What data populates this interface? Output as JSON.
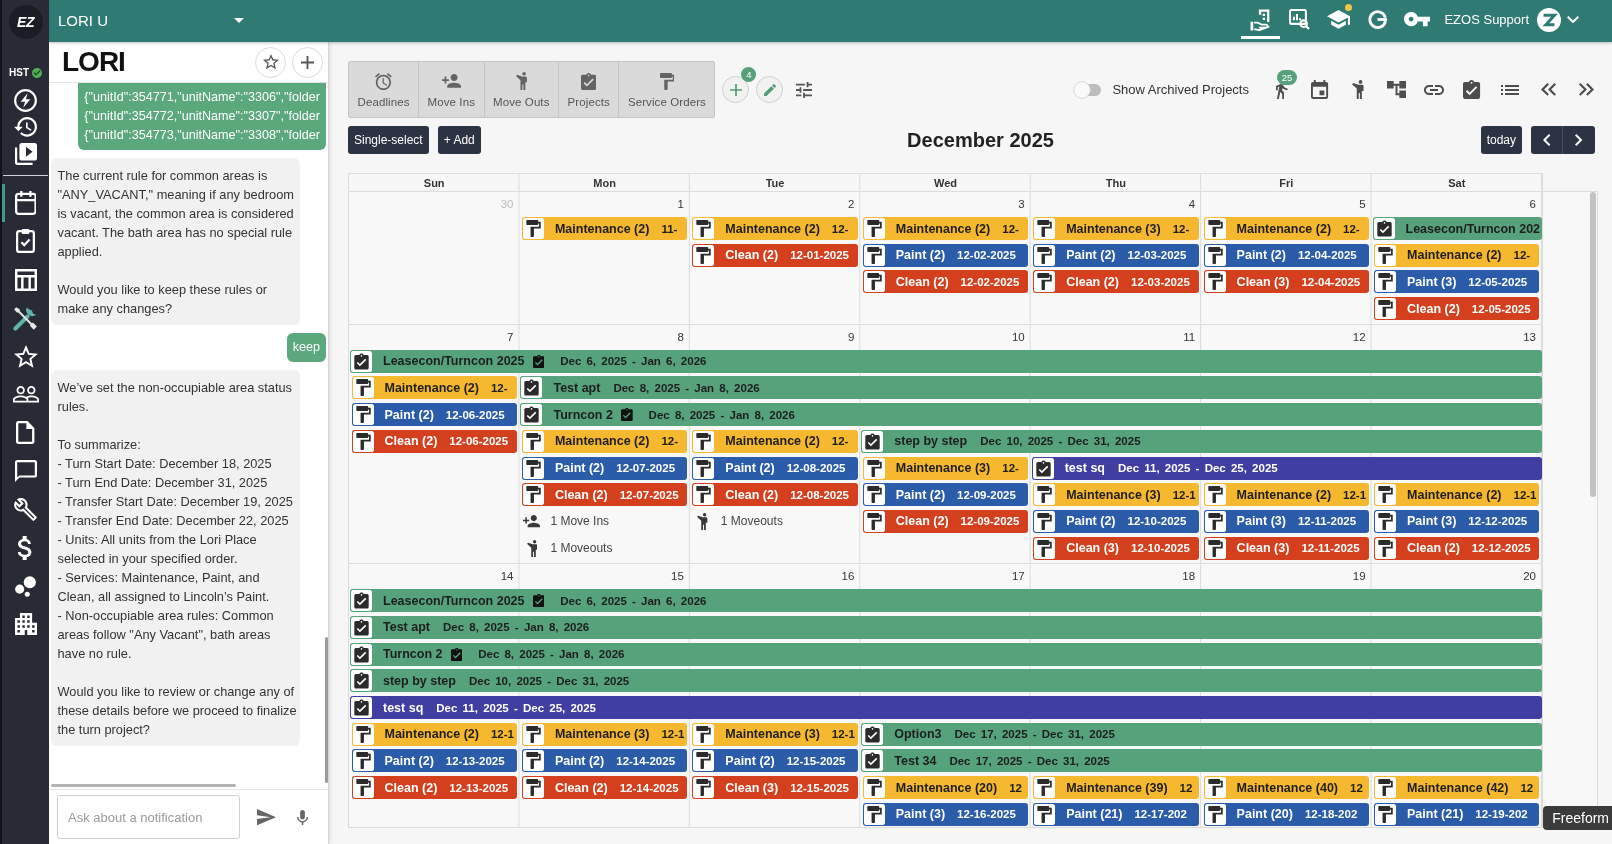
{
  "rail": {
    "logo": "EZ",
    "status": "HST",
    "tools": [
      {
        "selected": false
      },
      {
        "selected": false
      },
      {
        "selected": false
      }
    ],
    "items": [
      {
        "selected": true
      },
      {
        "selected": false
      },
      {
        "selected": false
      },
      {
        "selected": false
      },
      {
        "selected": false
      },
      {
        "selected": false
      },
      {
        "selected": false
      },
      {
        "selected": false
      },
      {
        "selected": false
      },
      {
        "selected": false
      },
      {
        "selected": false
      },
      {
        "selected": false
      }
    ]
  },
  "header": {
    "account": "LORI U",
    "tabs": [
      {
        "selected": true,
        "notification": false
      },
      {
        "selected": false,
        "notification": false
      },
      {
        "selected": false,
        "notification": true
      },
      {
        "selected": false,
        "notification": false
      },
      {
        "selected": false,
        "notification": false
      }
    ],
    "user": "EZOS Support"
  },
  "assistant": {
    "brand": "LORI",
    "messages": [
      {
        "kind": "user",
        "text": "{\"unitId\":354771,\"unitName\":\"3306\",\"folder\n{\"unitId\":354772,\"unitName\":\"3307\",\"folder\n{\"unitId\":354773,\"unitName\":\"3308\",\"folder"
      },
      {
        "kind": "assistant",
        "text": "The current rule for common areas is \"ANY_VACANT,\" meaning if any bedroom is vacant, the common area is considered vacant. The bath area has no special rule applied.\n\nWould you like to keep these rules or make any changes?"
      },
      {
        "kind": "user",
        "text": "keep"
      },
      {
        "kind": "assistant",
        "text": "We’ve set the non-occupiable area status rules.\n\nTo summarize:\n- Turn Start Date: December 18, 2025\n- Turn End Date: December 31, 2025\n- Transfer Start Date: December 19, 2025\n- Transfer End Date: December 22, 2025\n- Units: All units from the Lori Place selected in your specified order.\n- Services: Maintenance, Paint, and Clean, all assigned to Lincoln’s Paint.\n- Non-occupiable area rules: Common areas follow \"Any Vacant\", bath areas have no rule.\n\nWould you like to review or change any of these details before we proceed to finalize the turn project?"
      }
    ],
    "input": {
      "placeholder": "Ask about a notification"
    }
  },
  "toolbar": {
    "views": [
      {
        "label": "Deadlines"
      },
      {
        "label": "Move Ins"
      },
      {
        "label": "Move Outs"
      },
      {
        "label": "Projects"
      },
      {
        "label": "Service Orders"
      }
    ],
    "add_badge": "4",
    "archived": {
      "label": "Show Archived Projects",
      "on": false
    },
    "badge": "25"
  },
  "calendar": {
    "select_button": "Single-select",
    "add_button": "+ Add",
    "title": "December 2025",
    "today_button": "today",
    "weekdays": [
      "Sun",
      "Mon",
      "Tue",
      "Wed",
      "Thu",
      "Fri",
      "Sat"
    ],
    "weeks": [
      {
        "days": [
          {
            "number": "30",
            "other_month": true
          },
          {
            "number": "1",
            "other_month": false
          },
          {
            "number": "2",
            "other_month": false
          },
          {
            "number": "3",
            "other_month": false
          },
          {
            "number": "4",
            "other_month": false
          },
          {
            "number": "5",
            "other_month": false
          },
          {
            "number": "6",
            "other_month": false
          }
        ],
        "lanes": [
          [
            {
              "kind": "gap"
            },
            {
              "kind": "task",
              "label": "Maintenance (2)",
              "date": "11-",
              "color": "#f5b82e"
            },
            {
              "kind": "task",
              "label": "Maintenance (2)",
              "date": "12-",
              "color": "#f5b82e"
            },
            {
              "kind": "task",
              "label": "Maintenance (2)",
              "date": "12-",
              "color": "#f5b82e"
            },
            {
              "kind": "task",
              "label": "Maintenance (3)",
              "date": "12-",
              "color": "#f5b82e"
            },
            {
              "kind": "task",
              "label": "Maintenance (2)",
              "date": "12-",
              "color": "#f5b82e"
            },
            {
              "kind": "project",
              "label": "Leasecon/Turncon 202",
              "color": "#56a27a"
            }
          ],
          [
            {
              "kind": "gap"
            },
            {
              "kind": "gap"
            },
            {
              "kind": "task",
              "label": "Clean (2)",
              "date": "12-01-2025",
              "color": "#d4401e"
            },
            {
              "kind": "task",
              "label": "Paint (2)",
              "date": "12-02-2025",
              "color": "#2a5caa"
            },
            {
              "kind": "task",
              "label": "Paint (2)",
              "date": "12-03-2025",
              "color": "#2a5caa"
            },
            {
              "kind": "task",
              "label": "Paint (2)",
              "date": "12-04-2025",
              "color": "#2a5caa"
            },
            {
              "kind": "task",
              "label": "Maintenance (2)",
              "date": "12-",
              "color": "#f5b82e"
            }
          ],
          [
            {
              "kind": "gap"
            },
            {
              "kind": "gap"
            },
            {
              "kind": "gap"
            },
            {
              "kind": "task",
              "label": "Clean (2)",
              "date": "12-02-2025",
              "color": "#d4401e"
            },
            {
              "kind": "task",
              "label": "Clean (2)",
              "date": "12-03-2025",
              "color": "#d4401e"
            },
            {
              "kind": "task",
              "label": "Clean (3)",
              "date": "12-04-2025",
              "color": "#d4401e"
            },
            {
              "kind": "task",
              "label": "Paint (3)",
              "date": "12-05-2025",
              "color": "#2a5caa"
            }
          ],
          [
            {
              "kind": "gap"
            },
            {
              "kind": "gap"
            },
            {
              "kind": "gap"
            },
            {
              "kind": "gap"
            },
            {
              "kind": "gap"
            },
            {
              "kind": "gap"
            },
            {
              "kind": "task",
              "label": "Clean (2)",
              "date": "12-05-2025",
              "color": "#d4401e"
            }
          ]
        ]
      },
      {
        "days": [
          {
            "number": "7",
            "other_month": false
          },
          {
            "number": "8",
            "other_month": false
          },
          {
            "number": "9",
            "other_month": false
          },
          {
            "number": "10",
            "other_month": false
          },
          {
            "number": "11",
            "other_month": false
          },
          {
            "number": "12",
            "other_month": false
          },
          {
            "number": "13",
            "other_month": false
          }
        ],
        "lanes": [
          [
            {
              "kind": "project",
              "label": "Leasecon/Turncon 2025",
              "marked": true,
              "dates": "Dec 6, 2025 - Jan 6, 2026",
              "color": "#56a27a"
            }
          ],
          [
            {
              "kind": "task",
              "label": "Maintenance (2)",
              "date": "12-",
              "color": "#f5b82e"
            },
            {
              "kind": "project",
              "label": "Test apt",
              "marked": false,
              "dates": "Dec 8, 2025 - Jan 8, 2026",
              "color": "#56a27a"
            }
          ],
          [
            {
              "kind": "task",
              "label": "Paint (2)",
              "date": "12-06-2025",
              "color": "#2a5caa"
            },
            {
              "kind": "project",
              "label": "Turncon 2",
              "marked": true,
              "dates": "Dec 8, 2025 - Jan 8, 2026",
              "color": "#56a27a"
            }
          ],
          [
            {
              "kind": "task",
              "label": "Clean (2)",
              "date": "12-06-2025",
              "color": "#d4401e"
            },
            {
              "kind": "task",
              "label": "Maintenance (2)",
              "date": "12-",
              "color": "#f5b82e"
            },
            {
              "kind": "task",
              "label": "Maintenance (2)",
              "date": "12-",
              "color": "#f5b82e"
            },
            {
              "kind": "project",
              "label": "step by step",
              "marked": false,
              "dates": "Dec 10, 2025 - Dec 31, 2025",
              "color": "#56a27a"
            }
          ],
          [
            {
              "kind": "gap"
            },
            {
              "kind": "task",
              "label": "Paint (2)",
              "date": "12-07-2025",
              "color": "#2a5caa"
            },
            {
              "kind": "task",
              "label": "Paint (2)",
              "date": "12-08-2025",
              "color": "#2a5caa"
            },
            {
              "kind": "task",
              "label": "Maintenance (3)",
              "date": "12-",
              "color": "#f5b82e"
            },
            {
              "kind": "project",
              "label": "test sq",
              "marked": false,
              "dates": "Dec 11, 2025 - Dec 25, 2025",
              "color": "#403ea1"
            }
          ],
          [
            {
              "kind": "gap"
            },
            {
              "kind": "task",
              "label": "Clean (2)",
              "date": "12-07-2025",
              "color": "#d4401e"
            },
            {
              "kind": "task",
              "label": "Clean (2)",
              "date": "12-08-2025",
              "color": "#d4401e"
            },
            {
              "kind": "task",
              "label": "Paint (2)",
              "date": "12-09-2025",
              "color": "#2a5caa"
            },
            {
              "kind": "task",
              "label": "Maintenance (3)",
              "date": "12-1",
              "color": "#f5b82e"
            },
            {
              "kind": "task",
              "label": "Maintenance (2)",
              "date": "12-1",
              "color": "#f5b82e"
            },
            {
              "kind": "task",
              "label": "Maintenance (2)",
              "date": "12-1",
              "color": "#f5b82e"
            }
          ],
          [
            {
              "kind": "gap"
            },
            {
              "kind": "move_in",
              "label": "1 Move Ins"
            },
            {
              "kind": "move_out",
              "label": "1 Moveouts"
            },
            {
              "kind": "task",
              "label": "Clean (2)",
              "date": "12-09-2025",
              "color": "#d4401e"
            },
            {
              "kind": "task",
              "label": "Paint (2)",
              "date": "12-10-2025",
              "color": "#2a5caa"
            },
            {
              "kind": "task",
              "label": "Paint (3)",
              "date": "12-11-2025",
              "color": "#2a5caa"
            },
            {
              "kind": "task",
              "label": "Paint (3)",
              "date": "12-12-2025",
              "color": "#2a5caa"
            }
          ],
          [
            {
              "kind": "gap"
            },
            {
              "kind": "move_out",
              "label": "1 Moveouts"
            },
            {
              "kind": "gap"
            },
            {
              "kind": "gap"
            },
            {
              "kind": "task",
              "label": "Clean (3)",
              "date": "12-10-2025",
              "color": "#d4401e"
            },
            {
              "kind": "task",
              "label": "Clean (3)",
              "date": "12-11-2025",
              "color": "#d4401e"
            },
            {
              "kind": "task",
              "label": "Clean (2)",
              "date": "12-12-2025",
              "color": "#d4401e"
            }
          ]
        ]
      },
      {
        "days": [
          {
            "number": "14",
            "other_month": false
          },
          {
            "number": "15",
            "other_month": false
          },
          {
            "number": "16",
            "other_month": false
          },
          {
            "number": "17",
            "other_month": false
          },
          {
            "number": "18",
            "other_month": false
          },
          {
            "number": "19",
            "other_month": false
          },
          {
            "number": "20",
            "other_month": false
          }
        ],
        "lanes": [
          [
            {
              "kind": "project",
              "label": "Leasecon/Turncon 2025",
              "marked": true,
              "dates": "Dec 6, 2025 - Jan 6, 2026",
              "color": "#56a27a"
            }
          ],
          [
            {
              "kind": "project",
              "label": "Test apt",
              "marked": false,
              "dates": "Dec 8, 2025 - Jan 8, 2026",
              "color": "#56a27a"
            }
          ],
          [
            {
              "kind": "project",
              "label": "Turncon 2",
              "marked": true,
              "dates": "Dec 8, 2025 - Jan 8, 2026",
              "color": "#56a27a"
            }
          ],
          [
            {
              "kind": "project",
              "label": "step by step",
              "marked": false,
              "dates": "Dec 10, 2025 - Dec 31, 2025",
              "color": "#56a27a"
            }
          ],
          [
            {
              "kind": "project",
              "label": "test sq",
              "marked": false,
              "dates": "Dec 11, 2025 - Dec 25, 2025",
              "color": "#403ea1"
            }
          ],
          [
            {
              "kind": "task",
              "label": "Maintenance (2)",
              "date": "12-1",
              "color": "#f5b82e"
            },
            {
              "kind": "task",
              "label": "Maintenance (3)",
              "date": "12-1",
              "color": "#f5b82e"
            },
            {
              "kind": "task",
              "label": "Maintenance (3)",
              "date": "12-1",
              "color": "#f5b82e"
            },
            {
              "kind": "project",
              "label": "Option3",
              "marked": false,
              "dates": "Dec 17, 2025 - Dec 31, 2025",
              "color": "#56a27a"
            }
          ],
          [
            {
              "kind": "task",
              "label": "Paint (2)",
              "date": "12-13-2025",
              "color": "#2a5caa"
            },
            {
              "kind": "task",
              "label": "Paint (2)",
              "date": "12-14-2025",
              "color": "#2a5caa"
            },
            {
              "kind": "task",
              "label": "Paint (2)",
              "date": "12-15-2025",
              "color": "#2a5caa"
            },
            {
              "kind": "project",
              "label": "Test 34",
              "marked": false,
              "dates": "Dec 17, 2025 - Dec 31, 2025",
              "color": "#56a27a"
            }
          ],
          [
            {
              "kind": "task",
              "label": "Clean (2)",
              "date": "12-13-2025",
              "color": "#d4401e"
            },
            {
              "kind": "task",
              "label": "Clean (2)",
              "date": "12-14-2025",
              "color": "#d4401e"
            },
            {
              "kind": "task",
              "label": "Clean (3)",
              "date": "12-15-2025",
              "color": "#d4401e"
            },
            {
              "kind": "task",
              "label": "Maintenance (20)",
              "date": "12",
              "color": "#f5b82e"
            },
            {
              "kind": "task",
              "label": "Maintenance (39)",
              "date": "12",
              "color": "#f5b82e"
            },
            {
              "kind": "task",
              "label": "Maintenance (40)",
              "date": "12",
              "color": "#f5b82e"
            },
            {
              "kind": "task",
              "label": "Maintenance (42)",
              "date": "12",
              "color": "#f5b82e"
            }
          ],
          [
            {
              "kind": "gap"
            },
            {
              "kind": "gap"
            },
            {
              "kind": "gap"
            },
            {
              "kind": "task",
              "label": "Paint (3)",
              "date": "12-16-2025",
              "color": "#2a5caa"
            },
            {
              "kind": "task",
              "label": "Paint (21)",
              "date": "12-17-202",
              "color": "#2a5caa"
            },
            {
              "kind": "task",
              "label": "Paint (20)",
              "date": "12-18-202",
              "color": "#2a5caa"
            },
            {
              "kind": "task",
              "label": "Paint (21)",
              "date": "12-19-202",
              "color": "#2a5caa"
            }
          ]
        ]
      }
    ]
  },
  "tooltip": "Freeform"
}
